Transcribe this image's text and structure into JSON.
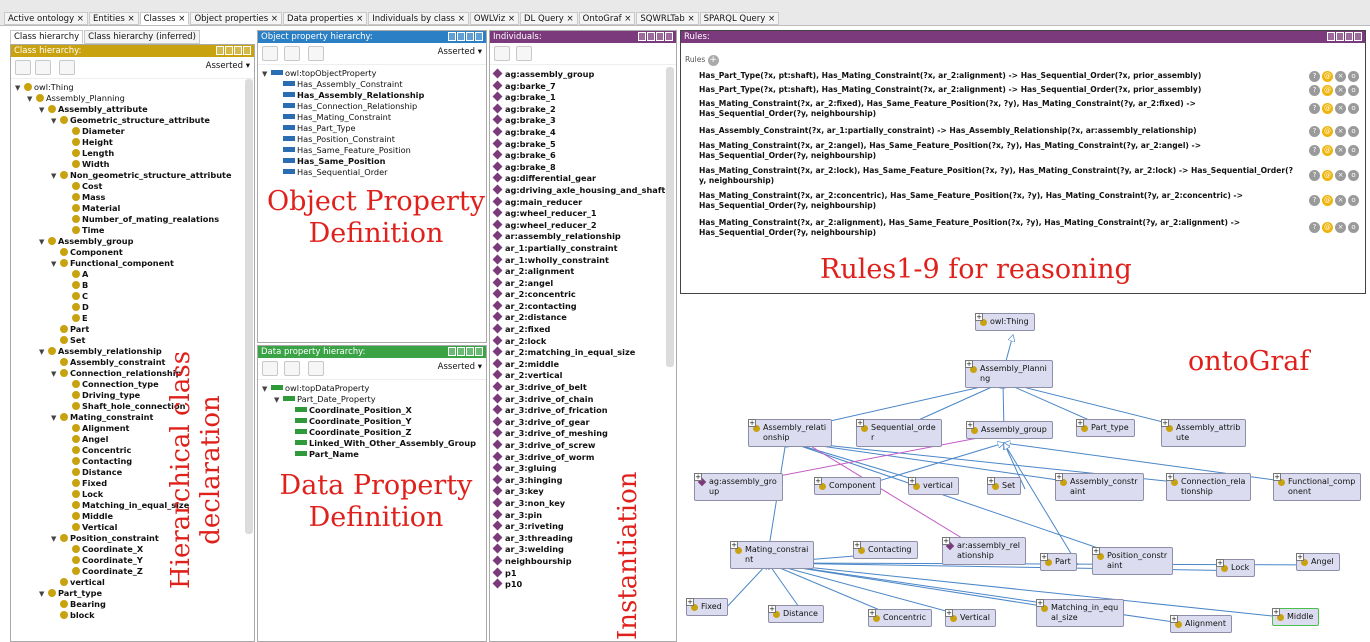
{
  "tabs": [
    "Active ontology",
    "Entities",
    "Classes",
    "Object properties",
    "Data properties",
    "Individuals by class",
    "OWLViz",
    "DL Query",
    "OntoGraf",
    "SQWRLTab",
    "SPARQL Query"
  ],
  "subtabs": [
    "Class hierarchy",
    "Class hierarchy (inferred)"
  ],
  "class_panel": {
    "title": "Class hierarchy:",
    "asserted": "Asserted"
  },
  "class_tree": [
    {
      "t": "owl:Thing",
      "d": 0,
      "b": false
    },
    {
      "t": "Assembly_Planning",
      "d": 1,
      "b": false
    },
    {
      "t": "Assembly_attribute",
      "d": 2,
      "b": true
    },
    {
      "t": "Geometric_structure_attribute",
      "d": 3,
      "b": true
    },
    {
      "t": "Diameter",
      "d": 4,
      "b": true
    },
    {
      "t": "Height",
      "d": 4,
      "b": true
    },
    {
      "t": "Length",
      "d": 4,
      "b": true
    },
    {
      "t": "Width",
      "d": 4,
      "b": true
    },
    {
      "t": "Non_geometric_structure_attribute",
      "d": 3,
      "b": true
    },
    {
      "t": "Cost",
      "d": 4,
      "b": true
    },
    {
      "t": "Mass",
      "d": 4,
      "b": true
    },
    {
      "t": "Material",
      "d": 4,
      "b": true
    },
    {
      "t": "Number_of_mating_realations",
      "d": 4,
      "b": true
    },
    {
      "t": "Time",
      "d": 4,
      "b": true
    },
    {
      "t": "Assembly_group",
      "d": 2,
      "b": true
    },
    {
      "t": "Component",
      "d": 3,
      "b": true
    },
    {
      "t": "Functional_component",
      "d": 3,
      "b": true
    },
    {
      "t": "A",
      "d": 4,
      "b": true
    },
    {
      "t": "B",
      "d": 4,
      "b": true
    },
    {
      "t": "C",
      "d": 4,
      "b": true
    },
    {
      "t": "D",
      "d": 4,
      "b": true
    },
    {
      "t": "E",
      "d": 4,
      "b": true
    },
    {
      "t": "Part",
      "d": 3,
      "b": true
    },
    {
      "t": "Set",
      "d": 3,
      "b": true
    },
    {
      "t": "Assembly_relationship",
      "d": 2,
      "b": true
    },
    {
      "t": "Assembly_constraint",
      "d": 3,
      "b": true
    },
    {
      "t": "Connection_relationship",
      "d": 3,
      "b": true
    },
    {
      "t": "Connection_type",
      "d": 4,
      "b": true
    },
    {
      "t": "Driving_type",
      "d": 4,
      "b": true
    },
    {
      "t": "Shaft_hole_connection",
      "d": 4,
      "b": true
    },
    {
      "t": "Mating_constraint",
      "d": 3,
      "b": true
    },
    {
      "t": "Alignment",
      "d": 4,
      "b": true
    },
    {
      "t": "Angel",
      "d": 4,
      "b": true
    },
    {
      "t": "Concentric",
      "d": 4,
      "b": true
    },
    {
      "t": "Contacting",
      "d": 4,
      "b": true
    },
    {
      "t": "Distance",
      "d": 4,
      "b": true
    },
    {
      "t": "Fixed",
      "d": 4,
      "b": true
    },
    {
      "t": "Lock",
      "d": 4,
      "b": true
    },
    {
      "t": "Matching_in_equal_size",
      "d": 4,
      "b": true
    },
    {
      "t": "Middle",
      "d": 4,
      "b": true
    },
    {
      "t": "Vertical",
      "d": 4,
      "b": true
    },
    {
      "t": "Position_constraint",
      "d": 3,
      "b": true
    },
    {
      "t": "Coordinate_X",
      "d": 4,
      "b": true
    },
    {
      "t": "Coordinate_Y",
      "d": 4,
      "b": true
    },
    {
      "t": "Coordinate_Z",
      "d": 4,
      "b": true
    },
    {
      "t": "vertical",
      "d": 3,
      "b": true
    },
    {
      "t": "Part_type",
      "d": 2,
      "b": true
    },
    {
      "t": "Bearing",
      "d": 3,
      "b": true
    },
    {
      "t": "block",
      "d": 3,
      "b": true
    }
  ],
  "obj_panel": {
    "title": "Object property hierarchy:",
    "asserted": "Asserted"
  },
  "obj_tree": [
    {
      "t": "owl:topObjectProperty",
      "d": 0,
      "b": false
    },
    {
      "t": "Has_Assembly_Constraint",
      "d": 1,
      "b": false
    },
    {
      "t": "Has_Assembly_Relationship",
      "d": 1,
      "b": true
    },
    {
      "t": "Has_Connection_Relationship",
      "d": 1,
      "b": false
    },
    {
      "t": "Has_Mating_Constraint",
      "d": 1,
      "b": false
    },
    {
      "t": "Has_Part_Type",
      "d": 1,
      "b": false
    },
    {
      "t": "Has_Position_Constraint",
      "d": 1,
      "b": false
    },
    {
      "t": "Has_Same_Feature_Position",
      "d": 1,
      "b": false
    },
    {
      "t": "Has_Same_Position",
      "d": 1,
      "b": true
    },
    {
      "t": "Has_Sequential_Order",
      "d": 1,
      "b": false
    }
  ],
  "data_panel": {
    "title": "Data property hierarchy:",
    "asserted": "Asserted"
  },
  "data_tree": [
    {
      "t": "owl:topDataProperty",
      "d": 0,
      "b": false
    },
    {
      "t": "Part_Date_Property",
      "d": 1,
      "b": false
    },
    {
      "t": "Coordinate_Position_X",
      "d": 2,
      "b": true
    },
    {
      "t": "Coordinate_Position_Y",
      "d": 2,
      "b": true
    },
    {
      "t": "Coordinate_Position_Z",
      "d": 2,
      "b": true
    },
    {
      "t": "Linked_With_Other_Assembly_Group",
      "d": 2,
      "b": true
    },
    {
      "t": "Part_Name",
      "d": 2,
      "b": true
    }
  ],
  "ind_panel": {
    "title": "Individuals:"
  },
  "individuals": [
    "ag:assembly_group",
    "ag:barke_7",
    "ag:brake_1",
    "ag:brake_2",
    "ag:brake_3",
    "ag:brake_4",
    "ag:brake_5",
    "ag:brake_6",
    "ag:brake_8",
    "ag:differential_gear",
    "ag:driving_axle_housing_and_shaft",
    "ag:main_reducer",
    "ag:wheel_reducer_1",
    "ag:wheel_reducer_2",
    "ar:assembly_relationship",
    "ar_1:partially_constraint",
    "ar_1:wholly_constraint",
    "ar_2:alignment",
    "ar_2:angel",
    "ar_2:concentric",
    "ar_2:contacting",
    "ar_2:distance",
    "ar_2:fixed",
    "ar_2:lock",
    "ar_2:matching_in_equal_size",
    "ar_2:middle",
    "ar_2:vertical",
    "ar_3:drive_of_belt",
    "ar_3:drive_of_chain",
    "ar_3:drive_of_frication",
    "ar_3:drive_of_gear",
    "ar_3:drive_of_meshing",
    "ar_3:drive_of_screw",
    "ar_3:drive_of_worm",
    "ar_3:gluing",
    "ar_3:hinging",
    "ar_3:key",
    "ar_3:non_key",
    "ar_3:pin",
    "ar_3:riveting",
    "ar_3:threading",
    "ar_3:welding",
    "neighbourship",
    "p1",
    "p10"
  ],
  "rules_panel": {
    "title": "Rules:",
    "label": "Rules"
  },
  "rules": [
    "Has_Part_Type(?x, pt:shaft), Has_Mating_Constraint(?x, ar_2:alignment) -> Has_Sequential_Order(?x, prior_assembly)",
    "Has_Part_Type(?x, pt:shaft), Has_Mating_Constraint(?x, ar_2:alignment) -> Has_Sequential_Order(?x, prior_assembly)",
    "Has_Mating_Constraint(?x, ar_2:fixed), Has_Same_Feature_Position(?x, ?y), Has_Mating_Constraint(?y, ar_2:fixed) -> Has_Sequential_Order(?y, neighbourship)",
    "Has_Assembly_Constraint(?x, ar_1:partially_constraint) -> Has_Assembly_Relationship(?x, ar:assembly_relationship)",
    "Has_Mating_Constraint(?x, ar_2:angel), Has_Same_Feature_Position(?x, ?y), Has_Mating_Constraint(?y, ar_2:angel) -> Has_Sequential_Order(?y, neighbourship)",
    "Has_Mating_Constraint(?x, ar_2:lock), Has_Same_Feature_Position(?x, ?y), Has_Mating_Constraint(?y, ar_2:lock) -> Has_Sequential_Order(?y, neighbourship)",
    "Has_Mating_Constraint(?x, ar_2:concentric), Has_Same_Feature_Position(?x, ?y), Has_Mating_Constraint(?y, ar_2:concentric) -> Has_Sequential_Order(?y, neighbourship)",
    "Has_Mating_Constraint(?x, ar_2:alignment), Has_Same_Feature_Position(?x, ?y), Has_Mating_Constraint(?y, ar_2:alignment) -> Has_Sequential_Order(?y, neighbourship)"
  ],
  "annotations": {
    "object": "Object Property\nDefinition",
    "data": "Data Property\nDefinition",
    "hier": "Hierarchical class\ndeclaration",
    "inst": "Instantiation",
    "rules": "Rules1-9 for reasoning",
    "graf": "ontoGraf"
  },
  "graph_nodes": [
    {
      "id": "thing",
      "label": "owl:Thing",
      "kind": "class"
    },
    {
      "id": "ap",
      "label": "Assembly_Planni\nng",
      "kind": "class"
    },
    {
      "id": "ar",
      "label": "Assembly_relati\nonship",
      "kind": "class"
    },
    {
      "id": "so",
      "label": "Sequential_orde\nr",
      "kind": "class"
    },
    {
      "id": "ag",
      "label": "Assembly_group",
      "kind": "class"
    },
    {
      "id": "pt",
      "label": "Part_type",
      "kind": "class"
    },
    {
      "id": "aa",
      "label": "Assembly_attrib\nute",
      "kind": "class"
    },
    {
      "id": "agi",
      "label": "ag:assembly_gro\nup",
      "kind": "individual"
    },
    {
      "id": "comp",
      "label": "Component",
      "kind": "class"
    },
    {
      "id": "vert",
      "label": "vertical",
      "kind": "class"
    },
    {
      "id": "set",
      "label": "Set",
      "kind": "class"
    },
    {
      "id": "ac",
      "label": "Assembly_constr\naint",
      "kind": "class"
    },
    {
      "id": "cr",
      "label": "Connection_rela\ntionship",
      "kind": "class"
    },
    {
      "id": "fc",
      "label": "Functional_comp\nonent",
      "kind": "class"
    },
    {
      "id": "mc",
      "label": "Mating_constrai\nnt",
      "kind": "class"
    },
    {
      "id": "cont",
      "label": "Contacting",
      "kind": "class"
    },
    {
      "id": "ari",
      "label": "ar:assembly_rel\nationship",
      "kind": "individual"
    },
    {
      "id": "part",
      "label": "Part",
      "kind": "class"
    },
    {
      "id": "pc",
      "label": "Position_constr\naint",
      "kind": "class"
    },
    {
      "id": "lock",
      "label": "Lock",
      "kind": "class"
    },
    {
      "id": "angel",
      "label": "Angel",
      "kind": "class"
    },
    {
      "id": "fixed",
      "label": "Fixed",
      "kind": "class"
    },
    {
      "id": "dist",
      "label": "Distance",
      "kind": "class"
    },
    {
      "id": "conc",
      "label": "Concentric",
      "kind": "class"
    },
    {
      "id": "vert2",
      "label": "Vertical",
      "kind": "class"
    },
    {
      "id": "mies",
      "label": "Matching_in_equ\nal_size",
      "kind": "class"
    },
    {
      "id": "align",
      "label": "Alignment",
      "kind": "class"
    },
    {
      "id": "mid",
      "label": "Middle",
      "kind": "class"
    }
  ]
}
